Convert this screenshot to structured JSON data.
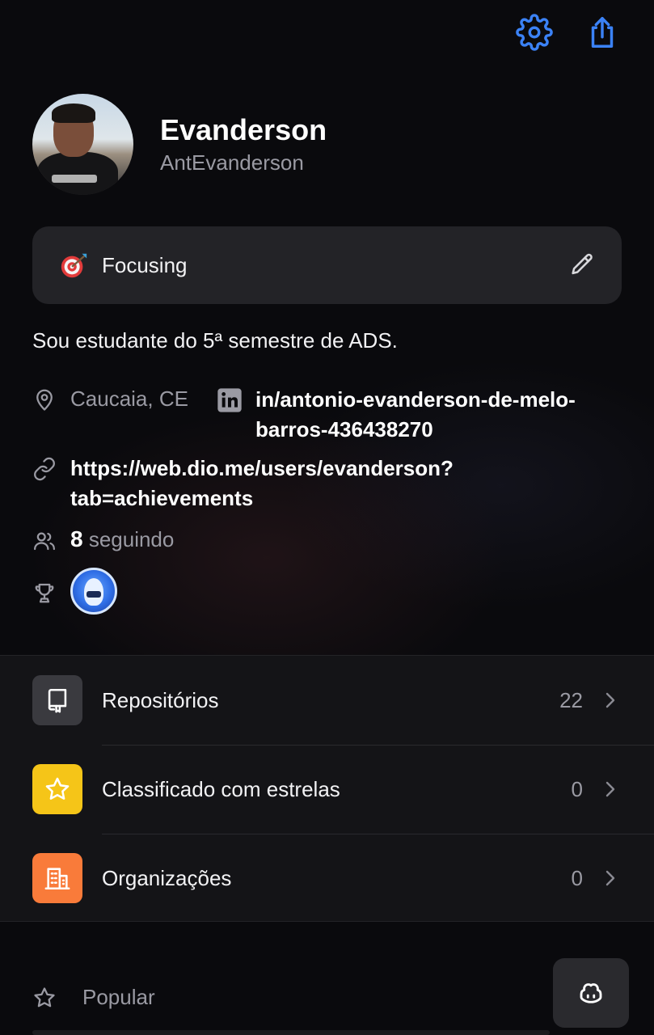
{
  "header": {
    "settings_icon": "gear-icon",
    "share_icon": "share-icon",
    "accent": "#3b82f6"
  },
  "profile": {
    "display_name": "Evanderson",
    "username": "AntEvanderson"
  },
  "status": {
    "emoji": "direct-hit-target",
    "label": "Focusing"
  },
  "bio": "Sou estudante do 5ª semestre de ADS.",
  "details": {
    "location": "Caucaia, CE",
    "linkedin": "in/antonio-evanderson-de-melo-barros-436438270",
    "website": "https://web.dio.me/users/evanderson?tab=achievements",
    "following_count": "8",
    "following_label": "seguindo"
  },
  "list": {
    "items": [
      {
        "label": "Repositórios",
        "count": "22",
        "icon": "repo-icon",
        "color": "#3a3a3f"
      },
      {
        "label": "Classificado com estrelas",
        "count": "0",
        "icon": "star-icon",
        "color": "#f5c518"
      },
      {
        "label": "Organizações",
        "count": "0",
        "icon": "organization-icon",
        "color": "#f97b3a"
      }
    ]
  },
  "popular": {
    "label": "Popular"
  }
}
